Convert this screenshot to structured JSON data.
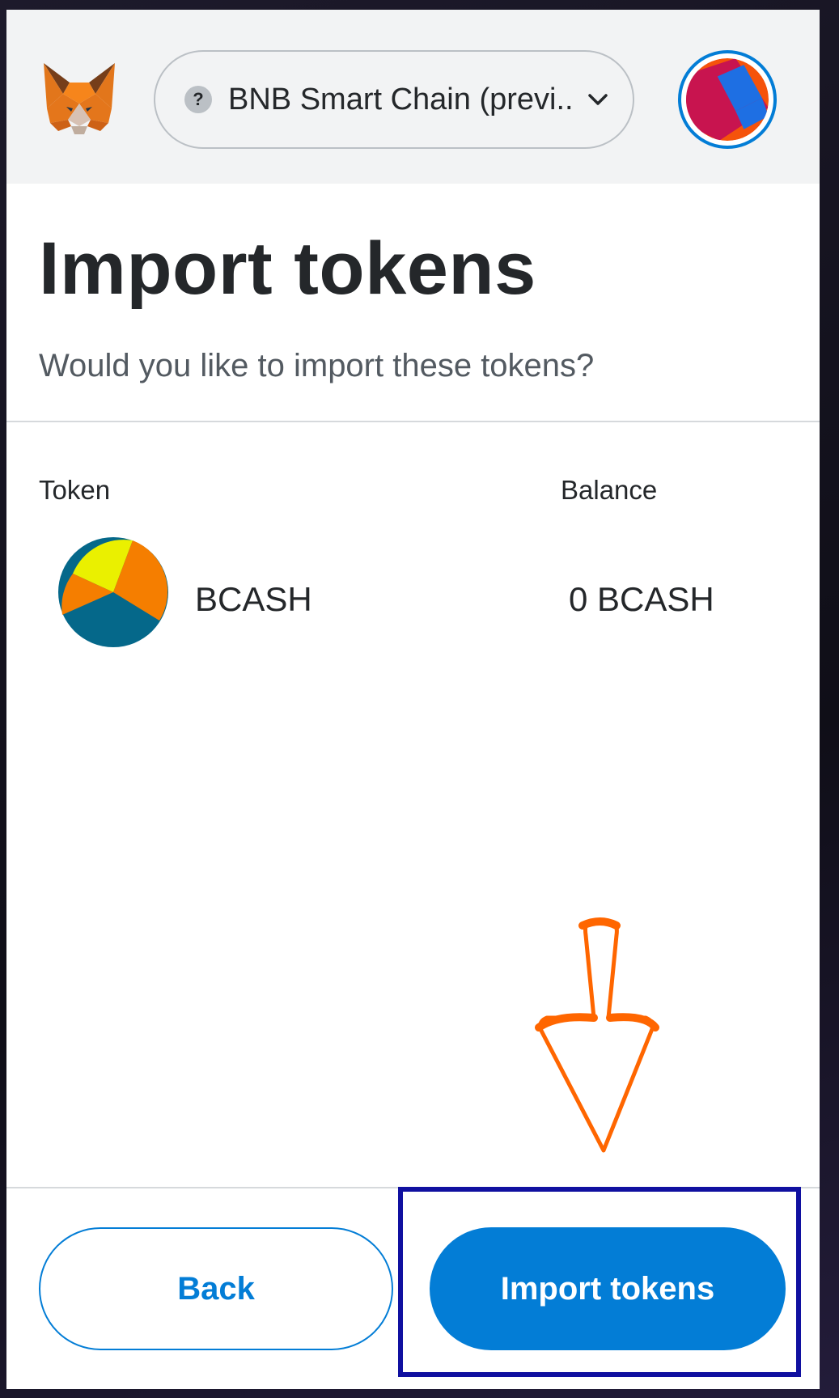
{
  "header": {
    "network_label": "BNB Smart Chain (previ...",
    "network_status_glyph": "?",
    "network_icon": "question-mark-icon",
    "chevron_icon": "chevron-down-icon",
    "logo_icon": "metamask-fox-icon",
    "avatar_icon": "account-identicon"
  },
  "page": {
    "title": "Import tokens",
    "subtitle": "Would you like to import these tokens?"
  },
  "table": {
    "columns": [
      "Token",
      "Balance"
    ],
    "rows": [
      {
        "symbol": "BCASH",
        "balance": "0 BCASH",
        "icon": "token-pie-icon"
      }
    ]
  },
  "footer": {
    "back_label": "Back",
    "import_label": "Import tokens"
  },
  "colors": {
    "primary": "#037dd6",
    "annotation_arrow": "#ff6600",
    "annotation_box": "#1010a0"
  }
}
